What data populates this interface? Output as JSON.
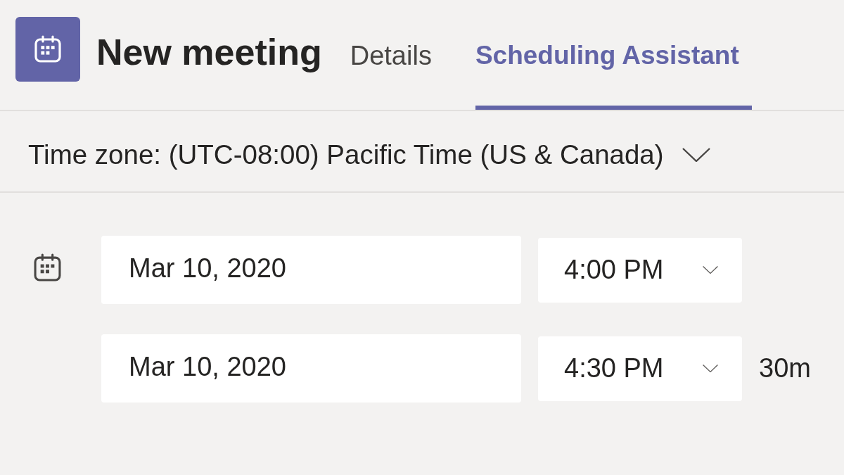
{
  "header": {
    "title": "New meeting",
    "tabs": [
      {
        "label": "Details",
        "selected": false
      },
      {
        "label": "Scheduling Assistant",
        "selected": true
      }
    ]
  },
  "time_zone": {
    "label": "Time zone: (UTC-08:00) Pacific Time (US & Canada)"
  },
  "schedule": [
    {
      "kind": "start",
      "date": "Mar 10, 2020",
      "time": "4:00 PM"
    },
    {
      "kind": "end",
      "date": "Mar 10, 2020",
      "time": "4:30 PM",
      "duration": "30m"
    }
  ]
}
